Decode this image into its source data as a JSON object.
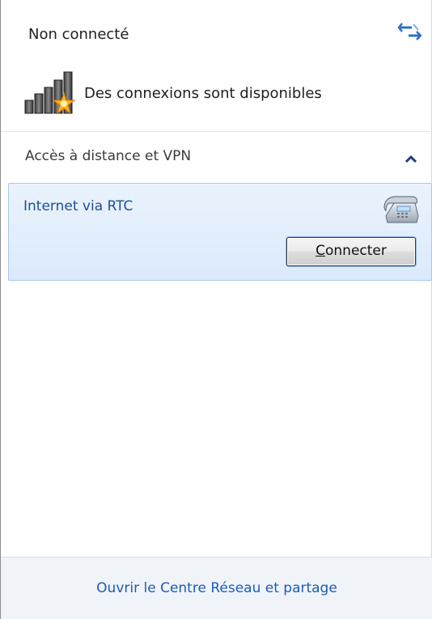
{
  "header": {
    "status_title": "Non connecté",
    "refresh_icon": "refresh-icon",
    "availability_text": "Des connexions sont disponibles",
    "signal_icon": "signal-bars-with-star-icon"
  },
  "section": {
    "title": "Accès à distance et VPN",
    "state": "expanded",
    "collapse_icon": "chevron-up-icon"
  },
  "connections": [
    {
      "name": "Internet via RTC",
      "icon": "dial-up-phone-icon",
      "button_label_mnemonic": "C",
      "button_label_rest": "onnecter",
      "selected": true
    }
  ],
  "footer": {
    "link_text": "Ouvrir le Centre Réseau et partage"
  },
  "colors": {
    "link": "#1e5bb8",
    "item_name": "#1f4e96",
    "selection_bg": "#dbeafb",
    "selection_border": "#a6c8ec",
    "footer_bg": "#f0f4f9"
  }
}
